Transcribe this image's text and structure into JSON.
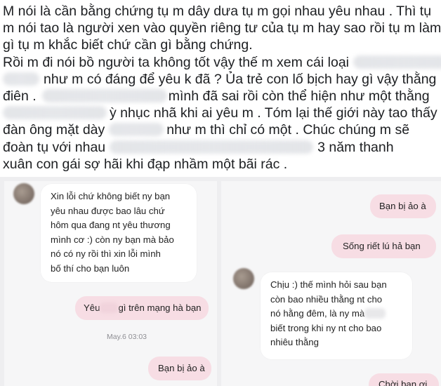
{
  "post": {
    "line1": "M nói là cần bằng chứng tụ m dây dưa tụ m gọi nhau yêu nhau . Thì tụ",
    "line2": "m nói tao là người xen vào quyền riêng tư của tụ m hay sao rồi tụ m làm",
    "line3": "gì tụ m khắc biết chứ cần gì bằng chứng.",
    "line4": "Rồi m đi nói bồ người ta không tốt vậy thế m xem cái loại",
    "line5": "như m có đáng để yêu k đã ? Ủa trẻ con lố bịch hay gì vậy thằng",
    "line6a": "điên .",
    "line6b": "mình đã sai rồi còn thể hiện như một thằng",
    "line7": "ỳ nhục nhã khi ai yêu m . Tóm lại thế giới này tao thấy",
    "line8a": "đàn ông mặt dày",
    "line8b": "như m thì chỉ có một . Chúc chúng m sẽ",
    "line9a": "đoàn tụ với nhau",
    "line9b": "3 năm thanh",
    "line10": "xuân con gái sợ hãi khi đạp nhầm một bãi rác ."
  },
  "left_chat": {
    "msg1": [
      "Xin lỗi chứ không biết ny bạn",
      "yêu nhau được bao lâu chứ",
      "hôm qua đang nt yêu thương",
      "mình cơ :) còn ny bạn mà bảo",
      "nó có ny rồi thì xin lỗi mình",
      "bố thí cho bạn luôn"
    ],
    "msg2_start": "Yêu",
    "msg2_end": "gì trên mạng hà bạn",
    "timestamp": "May.6 03:03",
    "msg3": "Bạn bị ảo à"
  },
  "right_chat": {
    "msg1": "Bạn bị ảo à",
    "msg2": "Sống riết lú hả bạn",
    "msg3_l1": "Chịu :) thế mình hỏi sau bạn",
    "msg3_l2": "còn bao nhiều thằng nt cho",
    "msg3_l3": "nó hằng đêm, là ny mà",
    "msg3_l4": "biết trong khi ny nt cho bao",
    "msg3_l5": "nhiêu thằng",
    "msg4": "Chời bạn ơi"
  }
}
